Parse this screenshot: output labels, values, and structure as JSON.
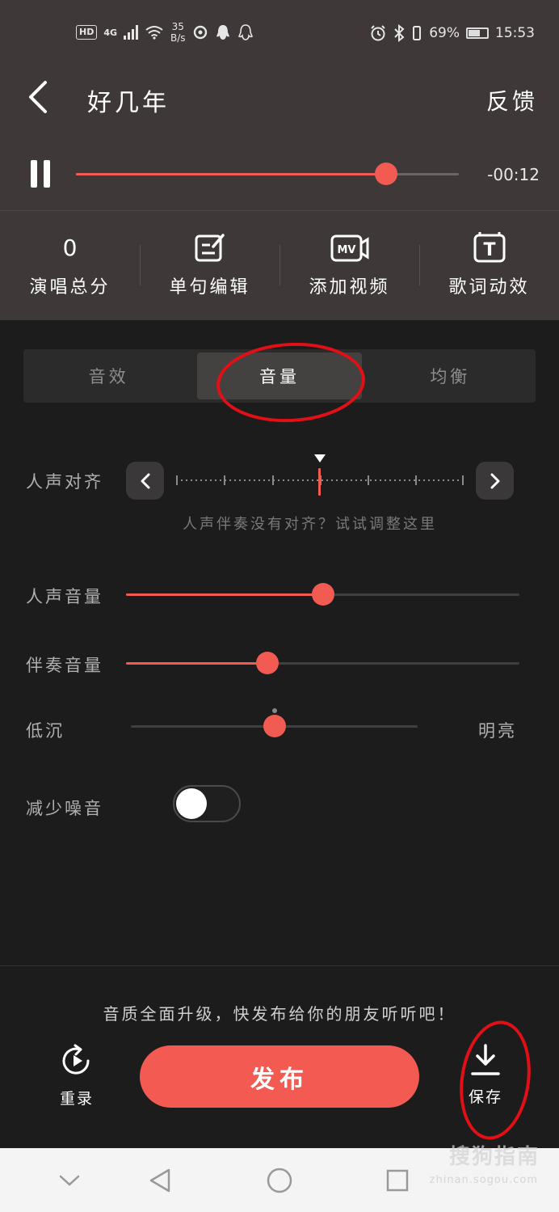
{
  "status_bar": {
    "hd": "HD",
    "network": "4G",
    "speed_value": "35",
    "speed_unit": "B/s",
    "battery": "69%",
    "time": "15:53"
  },
  "header": {
    "title": "好几年",
    "feedback": "反馈"
  },
  "player": {
    "progress": 0.81,
    "remaining": "-00:12"
  },
  "tools": [
    {
      "score": "0",
      "label": "演唱总分"
    },
    {
      "label": "单句编辑"
    },
    {
      "label": "添加视频",
      "icon_text": "MV"
    },
    {
      "label": "歌词动效",
      "icon_text": "T"
    }
  ],
  "tabs": [
    {
      "label": "音效",
      "active": false
    },
    {
      "label": "音量",
      "active": true
    },
    {
      "label": "均衡",
      "active": false
    }
  ],
  "vocal_align": {
    "label": "人声对齐",
    "hint": "人声伴奏没有对齐？试试调整这里",
    "value": 0.5
  },
  "vocal_volume": {
    "label": "人声音量",
    "value": 0.5
  },
  "accompaniment_volume": {
    "label": "伴奏音量",
    "value": 0.36
  },
  "tone": {
    "left_label": "低沉",
    "right_label": "明亮",
    "value": 0.5
  },
  "noise_reduction": {
    "label": "减少噪音",
    "enabled": false
  },
  "footer": {
    "promo": "音质全面升级，快发布给你的朋友听听吧！",
    "retry_label": "重录",
    "publish_label": "发布",
    "save_label": "保存"
  },
  "watermark": {
    "main": "搜狗指南",
    "sub": "zhinan.sogou.com"
  },
  "colors": {
    "accent": "#f25b52",
    "annotation": "#e20f17",
    "top_bg": "#3e3938",
    "main_bg": "#1c1c1c"
  }
}
